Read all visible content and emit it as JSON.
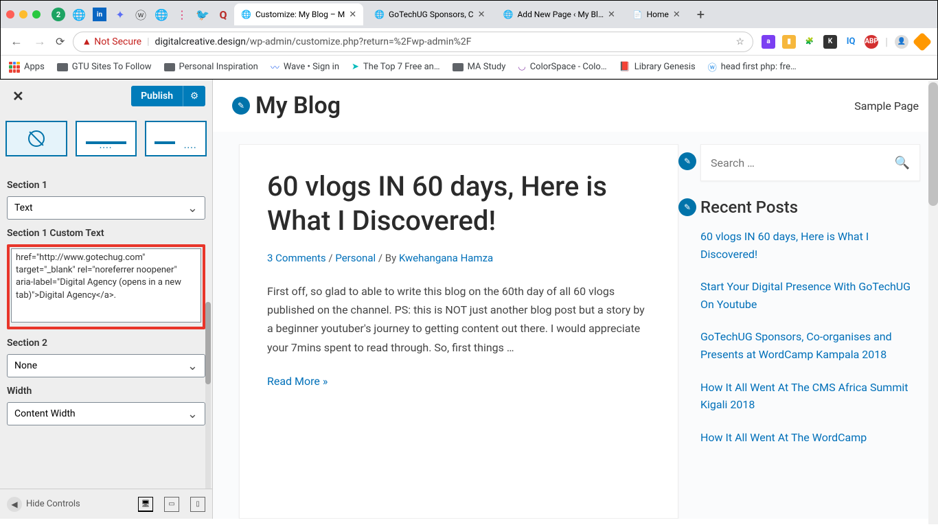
{
  "browser": {
    "tabs": [
      {
        "title": "Customize: My Blog – M",
        "active": true
      },
      {
        "title": "GoTechUG Sponsors, C"
      },
      {
        "title": "Add New Page ‹ My Bl…"
      },
      {
        "title": "Home"
      }
    ],
    "not_secure": "Not Secure",
    "url_host": "digitalcreative.design",
    "url_path": "/wp-admin/customize.php?return=%2Fwp-admin%2F",
    "bookmarks": {
      "apps": "Apps",
      "items": [
        "GTU Sites To Follow",
        "Personal Inspiration",
        "Wave • Sign in",
        "The Top 7 Free an…",
        "MA Study",
        "ColorSpace - Colo…",
        "Library Genesis",
        "head first php: fre…"
      ]
    }
  },
  "customizer": {
    "publish": "Publish",
    "section1_label": "Section 1",
    "section1_value": "Text",
    "custom_text_label": "Section 1 Custom Text",
    "custom_text_value": "href=\"http://www.gotechug.com\" target=\"_blank\" rel=\"noreferrer noopener\" aria-label=\"Digital Agency (opens in a new tab)\">Digital Agency</a>.",
    "section2_label": "Section 2",
    "section2_value": "None",
    "width_label": "Width",
    "width_value": "Content Width",
    "hide_controls": "Hide Controls"
  },
  "preview": {
    "site_title": "My Blog",
    "nav_link": "Sample Page",
    "search_placeholder": "Search …",
    "post": {
      "title": "60 vlogs IN 60 days, Here is What I Discovered!",
      "comments": "3 Comments",
      "category": "Personal",
      "by": " / By ",
      "author": "Kwehangana Hamza",
      "excerpt": "First off, so glad to able to write this blog on the 60th day of all 60 vlogs published on the channel. PS: this is NOT just another blog post but a story by a beginner youtuber's journey to getting content out there. I would appreciate your 7mins spent to read through. So, first things …",
      "read_more": "Read More »"
    },
    "recent_title": "Recent Posts",
    "recent": [
      "60 vlogs IN 60 days, Here is What I Discovered!",
      "Start Your Digital Presence With GoTechUG On Youtube",
      "GoTechUG Sponsors, Co-organises and Presents at WordCamp Kampala 2018",
      "How It All Went At The CMS Africa Summit Kigali 2018",
      "How It All Went At The WordCamp"
    ]
  }
}
